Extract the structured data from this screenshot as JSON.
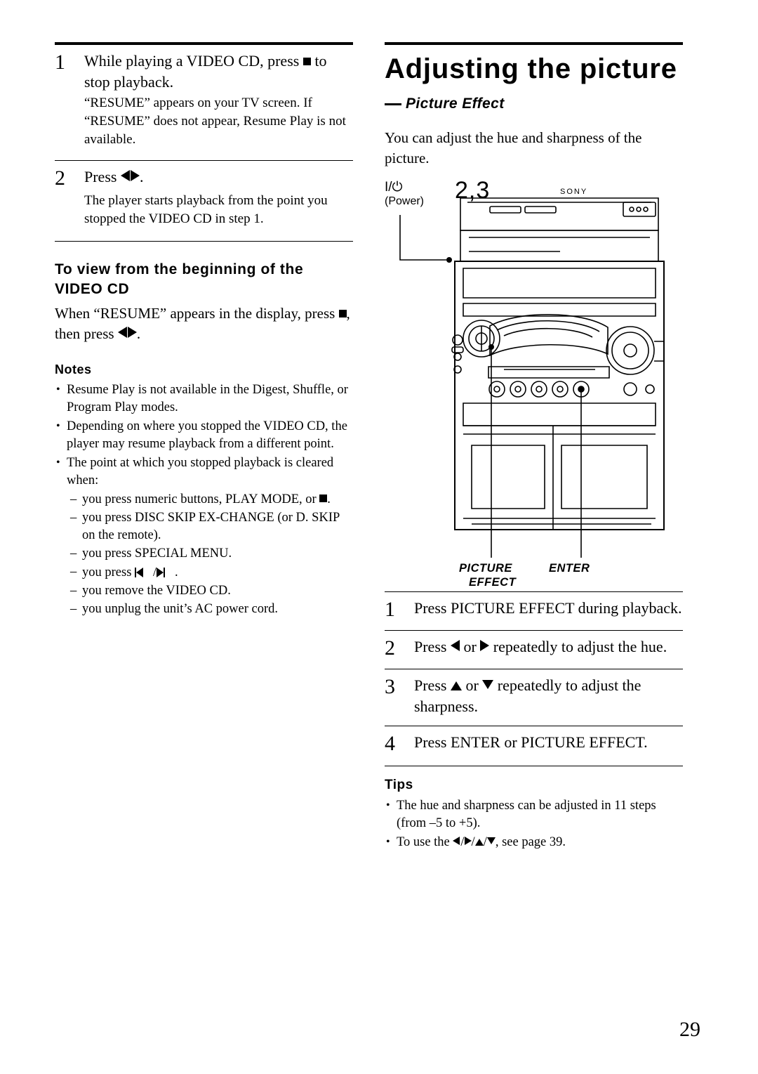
{
  "page_number": "29",
  "left_column": {
    "step1": {
      "num": "1",
      "text_before": "While playing a VIDEO CD, press",
      "text_after": "to stop playback.",
      "sub": "“RESUME” appears on your TV screen. If “RESUME” does not appear, Resume Play is not available."
    },
    "step2": {
      "num": "2",
      "text_before": "Press",
      "text_after": ".",
      "sub": "The player starts playback from the point you stopped the VIDEO CD in step 1."
    },
    "subhead": "To view from the beginning of the VIDEO CD",
    "subhead_body_a": "When “RESUME” appears in the display, press",
    "subhead_body_b": ", then press",
    "subhead_body_c": ".",
    "notes_title": "Notes",
    "notes": [
      "Resume Play is not available in the Digest, Shuffle, or Program Play modes.",
      "Depending on where you stopped the VIDEO CD, the player may resume playback from a different point.",
      "The point at which you stopped playback is cleared when:"
    ],
    "cleared_when": [
      "you press numeric buttons, PLAY MODE, or",
      "you press DISC SKIP EX-CHANGE (or D. SKIP on the remote).",
      "you press SPECIAL MENU.",
      "you press",
      "you remove the VIDEO CD.",
      "you unplug the unit’s AC power cord."
    ],
    "cleared_when_1_tail": ".",
    "cleared_when_4_tail": "."
  },
  "right_column": {
    "title": "Adjusting the picture",
    "section_label": "Picture Effect",
    "intro": "You can adjust the hue and sharpness of the picture.",
    "figure": {
      "power_symbol": "I/⏻",
      "power_label": "(Power)",
      "step_numbers": "2,3",
      "brand": "SONY",
      "label_picture": "PICTURE",
      "label_effect": "EFFECT",
      "label_enter": "ENTER"
    },
    "steps": [
      {
        "num": "1",
        "text": "Press PICTURE EFFECT during playback."
      },
      {
        "num": "2",
        "text_a": "Press",
        "text_b": "or",
        "text_c": "repeatedly to adjust the hue."
      },
      {
        "num": "3",
        "text_a": "Press",
        "text_b": "or",
        "text_c": "repeatedly to adjust the sharpness."
      },
      {
        "num": "4",
        "text": "Press ENTER or PICTURE EFFECT."
      }
    ],
    "tips_title": "Tips",
    "tips": [
      "The hue and sharpness can be adjusted in 11 steps (from –5 to +5).",
      "To use the"
    ],
    "tip2_tail": ", see page 39."
  }
}
